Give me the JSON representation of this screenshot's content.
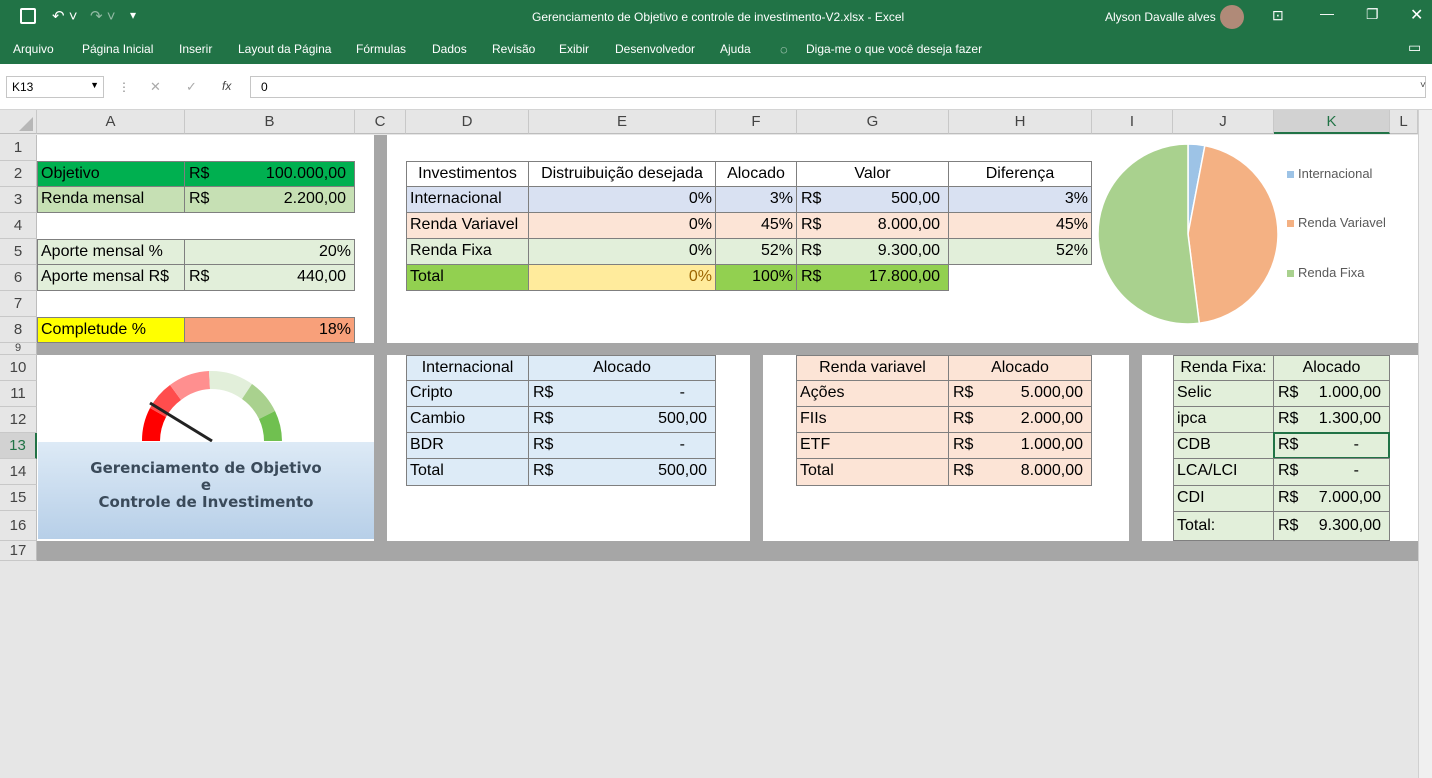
{
  "title": {
    "document": "Gerenciamento de Objetivo e controle de investimento-V2.xlsx  -  Excel",
    "user": "Alyson Davalle alves"
  },
  "ribbon": {
    "tabs": [
      "Arquivo",
      "Página Inicial",
      "Inserir",
      "Layout da Página",
      "Fórmulas",
      "Dados",
      "Revisão",
      "Exibir",
      "Desenvolvedor",
      "Ajuda"
    ],
    "tell_me": "Diga-me o que você deseja fazer"
  },
  "formula_bar": {
    "name_box": "K13",
    "fx": "fx",
    "value": "0"
  },
  "columns": [
    "A",
    "B",
    "C",
    "D",
    "E",
    "F",
    "G",
    "H",
    "I",
    "J",
    "K",
    "L"
  ],
  "rows": [
    "1",
    "2",
    "3",
    "4",
    "5",
    "6",
    "7",
    "8",
    "9",
    "10",
    "11",
    "12",
    "13",
    "14",
    "15",
    "16",
    "17"
  ],
  "goals": {
    "objetivo_label": "Objetivo",
    "objetivo_cur": "R$",
    "objetivo_val": "100.000,00",
    "renda_label": "Renda mensal",
    "renda_cur": "R$",
    "renda_val": "2.200,00",
    "aporte_pct_label": "Aporte mensal %",
    "aporte_pct_val": "20%",
    "aporte_rs_label": "Aporte mensal R$",
    "aporte_rs_cur": "R$",
    "aporte_rs_val": "440,00",
    "completude_label": "Completude %",
    "completude_val": "18%"
  },
  "logo": {
    "line1": "Gerenciamento de Objetivo",
    "line2": "e",
    "line3": "Controle de Investimento",
    "gauge_level": 0.18
  },
  "main_table": {
    "headers": [
      "Investimentos",
      "Distruibuição desejada",
      "Alocado",
      "Valor",
      "Diferença"
    ],
    "rows": [
      {
        "name": "Internacional",
        "dist": "0%",
        "aloc": "3%",
        "cur": "R$",
        "valor": "500,00",
        "dif": "3%"
      },
      {
        "name": "Renda Variavel",
        "dist": "0%",
        "aloc": "45%",
        "cur": "R$",
        "valor": "8.000,00",
        "dif": "45%"
      },
      {
        "name": "Renda Fixa",
        "dist": "0%",
        "aloc": "52%",
        "cur": "R$",
        "valor": "9.300,00",
        "dif": "52%"
      }
    ],
    "total": {
      "name": "Total",
      "dist": "0%",
      "aloc": "100%",
      "cur": "R$",
      "valor": "17.800,00"
    }
  },
  "pie": {
    "legend": [
      "Internacional",
      "Renda Variavel",
      "Renda Fixa"
    ],
    "values": [
      3,
      45,
      52
    ],
    "colors": [
      "#9dc3e6",
      "#f4b183",
      "#a9d18e"
    ]
  },
  "internacional": {
    "h1": "Internacional",
    "h2": "Alocado",
    "rows": [
      {
        "n": "Cripto",
        "c": "R$",
        "v": "-"
      },
      {
        "n": "Cambio",
        "c": "R$",
        "v": "500,00"
      },
      {
        "n": "BDR",
        "c": "R$",
        "v": "-"
      },
      {
        "n": "Total",
        "c": "R$",
        "v": "500,00"
      }
    ]
  },
  "renda_variavel": {
    "h1": "Renda variavel",
    "h2": "Alocado",
    "rows": [
      {
        "n": "Ações",
        "c": "R$",
        "v": "5.000,00"
      },
      {
        "n": "FIIs",
        "c": "R$",
        "v": "2.000,00"
      },
      {
        "n": "ETF",
        "c": "R$",
        "v": "1.000,00"
      },
      {
        "n": "Total",
        "c": "R$",
        "v": "8.000,00"
      }
    ]
  },
  "renda_fixa": {
    "h1": "Renda Fixa:",
    "h2": "Alocado",
    "rows": [
      {
        "n": "Selic",
        "c": "R$",
        "v": "1.000,00"
      },
      {
        "n": "ipca",
        "c": "R$",
        "v": "1.300,00"
      },
      {
        "n": "CDB",
        "c": "R$",
        "v": "-"
      },
      {
        "n": "LCA/LCI",
        "c": "R$",
        "v": "-"
      },
      {
        "n": "CDI",
        "c": "R$",
        "v": "7.000,00"
      },
      {
        "n": "Total:",
        "c": "R$",
        "v": "9.300,00"
      }
    ]
  }
}
